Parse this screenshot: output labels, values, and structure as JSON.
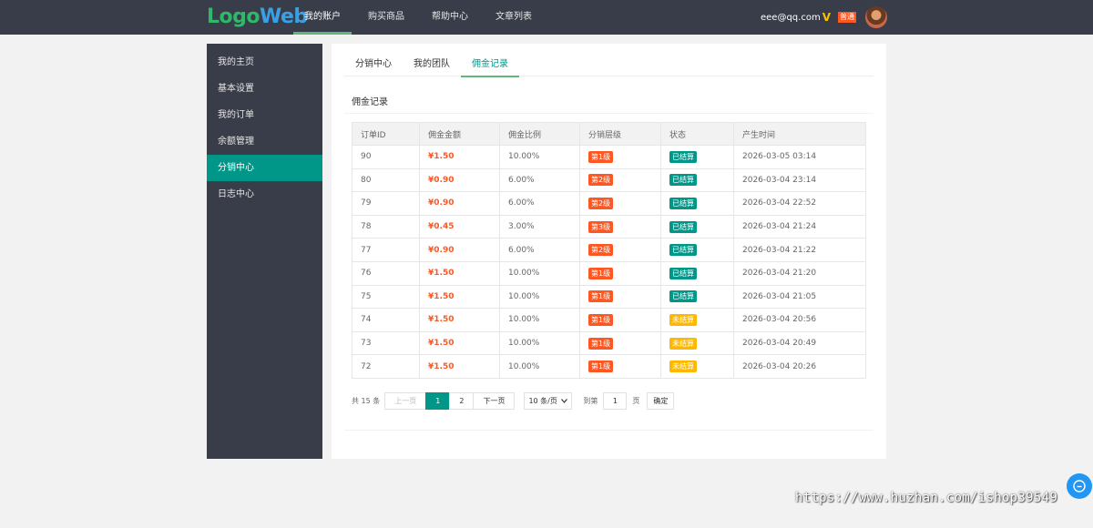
{
  "header": {
    "logo_part1": "Logo",
    "logo_part2": "Web",
    "nav": [
      "我的账户",
      "购买商品",
      "帮助中心",
      "文章列表"
    ],
    "user_email": "eee@qq.com",
    "vip_icon": "V",
    "user_level": "普通"
  },
  "sidebar": {
    "items": [
      "我的主页",
      "基本设置",
      "我的订单",
      "余额管理",
      "分销中心",
      "日志中心"
    ],
    "active": "分销中心"
  },
  "tabs": [
    "分销中心",
    "我的团队",
    "佣金记录"
  ],
  "section_title": "佣金记录",
  "table": {
    "headers": [
      "订单ID",
      "佣金金额",
      "佣金比例",
      "分销层级",
      "状态",
      "产生时间"
    ],
    "rows": [
      {
        "id": "90",
        "amount": "¥1.50",
        "ratio": "10.00%",
        "level": "第1级",
        "status": "已结算",
        "time": "2026-03-05 03:14"
      },
      {
        "id": "80",
        "amount": "¥0.90",
        "ratio": "6.00%",
        "level": "第2级",
        "status": "已结算",
        "time": "2026-03-04 23:14"
      },
      {
        "id": "79",
        "amount": "¥0.90",
        "ratio": "6.00%",
        "level": "第2级",
        "status": "已结算",
        "time": "2026-03-04 22:52"
      },
      {
        "id": "78",
        "amount": "¥0.45",
        "ratio": "3.00%",
        "level": "第3级",
        "status": "已结算",
        "time": "2026-03-04 21:24"
      },
      {
        "id": "77",
        "amount": "¥0.90",
        "ratio": "6.00%",
        "level": "第2级",
        "status": "已结算",
        "time": "2026-03-04 21:22"
      },
      {
        "id": "76",
        "amount": "¥1.50",
        "ratio": "10.00%",
        "level": "第1级",
        "status": "已结算",
        "time": "2026-03-04 21:20"
      },
      {
        "id": "75",
        "amount": "¥1.50",
        "ratio": "10.00%",
        "level": "第1级",
        "status": "已结算",
        "time": "2026-03-04 21:05"
      },
      {
        "id": "74",
        "amount": "¥1.50",
        "ratio": "10.00%",
        "level": "第1级",
        "status": "未结算",
        "time": "2026-03-04 20:56"
      },
      {
        "id": "73",
        "amount": "¥1.50",
        "ratio": "10.00%",
        "level": "第1级",
        "status": "未结算",
        "time": "2026-03-04 20:49"
      },
      {
        "id": "72",
        "amount": "¥1.50",
        "ratio": "10.00%",
        "level": "第1级",
        "status": "未结算",
        "time": "2026-03-04 20:26"
      }
    ]
  },
  "pagination": {
    "total_text": "共 15 条",
    "prev": "上一页",
    "pages": [
      "1",
      "2"
    ],
    "current": "1",
    "next": "下一页",
    "page_size": "10 条/页",
    "goto_prefix": "到第",
    "goto_value": "1",
    "goto_suffix": "页",
    "confirm": "确定"
  },
  "watermark": "https://www.huzhan.com/ishop39549",
  "colors": {
    "header_bg": "#393d49",
    "accent": "#009688",
    "amount": "#ff5722",
    "level_badge": "#ff5722",
    "settled": "#009688",
    "unsettled": "#ffb800",
    "float_button": "#2196f3"
  },
  "icons": {
    "float": "chat-bubble-icon",
    "select": "chevron-down-icon"
  }
}
